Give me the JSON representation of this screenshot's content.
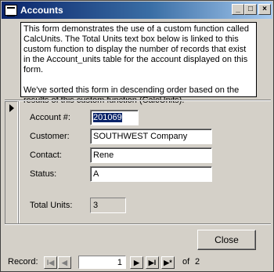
{
  "window": {
    "title": "Accounts",
    "controls": {
      "minimize": "_",
      "maximize": "□",
      "close": "×"
    }
  },
  "notes": {
    "paragraph1": "This form demonstrates the use of a custom function called CalcUnits.  The Total Units text box below is linked to this custom function to display the number of records that exist in the Account_units table for the account displayed on this form.",
    "paragraph2": "We've sorted this form in descending order based on the results of this custom function (CalcUnits)."
  },
  "form": {
    "account_label": "Account #:",
    "account_value": "201069",
    "customer_label": "Customer:",
    "customer_value": "SOUTHWEST Company",
    "contact_label": "Contact:",
    "contact_value": "Rene",
    "status_label": "Status:",
    "status_value": "A",
    "total_units_label": "Total Units:",
    "total_units_value": "3"
  },
  "buttons": {
    "close": "Close"
  },
  "navigation": {
    "record_label": "Record:",
    "first": "I◀",
    "prev": "◀",
    "current": "1",
    "next": "▶",
    "last": "▶I",
    "new": "▶*",
    "of_label": "of",
    "total": "2"
  }
}
